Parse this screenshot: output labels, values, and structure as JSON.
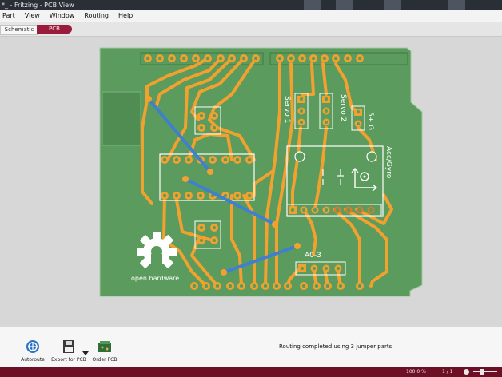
{
  "window": {
    "title": "*_ - Fritzing - PCB View"
  },
  "menu": {
    "items": [
      "Part",
      "View",
      "Window",
      "Routing",
      "Help"
    ]
  },
  "tabs": {
    "schematic": "Schematic",
    "pcb": "PCB"
  },
  "board": {
    "labels": {
      "servo1": "Servo 1",
      "servo2": "Servo 2",
      "five_v_gnd": "5+ G",
      "acc_gyro": "Acc/Gyro",
      "a0_3": "A0-3",
      "open_hardware": "open hardware"
    },
    "colors": {
      "board": "#5b9b5e",
      "trace": "#f2a12e",
      "jumper": "#3f7fd0",
      "silk": "#ffffff",
      "pad": "#f2a12e"
    }
  },
  "toolbar": {
    "autoroute": "Autoroute",
    "export": "Export for PCB",
    "order": "Order PCB"
  },
  "status": {
    "message": "Routing completed using 3 jumper parts",
    "zoom": "100.0 %",
    "page": "1 / 1"
  },
  "icons": {
    "autoroute": "autoroute-icon",
    "export": "floppy-disk-icon",
    "order": "pcb-board-icon",
    "dropdown": "triangle-down-icon"
  }
}
